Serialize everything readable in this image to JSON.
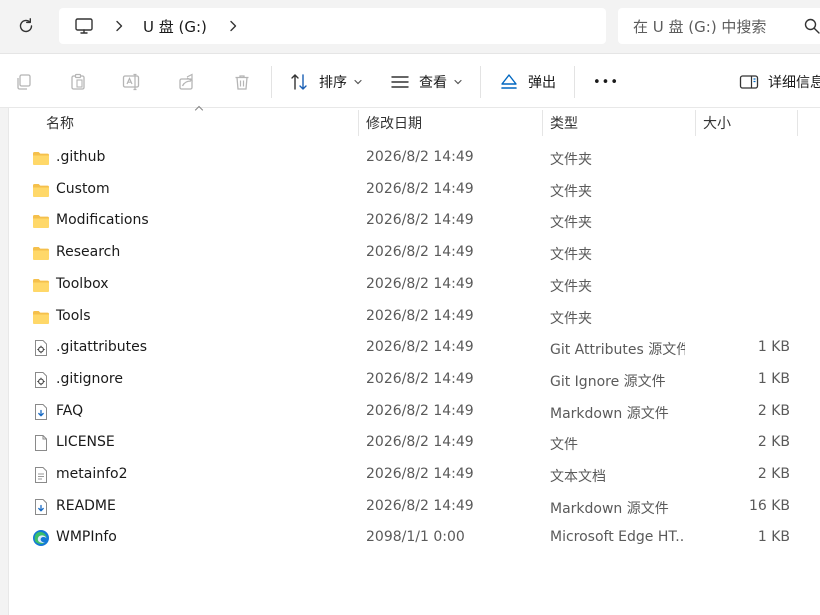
{
  "address": {
    "crumbs": [
      "U 盘 (G:)"
    ],
    "search_placeholder": "在 U 盘 (G:) 中搜索"
  },
  "icons": {
    "refresh": "refresh-icon",
    "pc": "computer-icon",
    "copy": "copy-icon",
    "paste": "paste-icon",
    "rename": "rename-icon",
    "share": "share-icon",
    "delete": "delete-icon",
    "sort": "sort-icon",
    "view": "view-icon",
    "eject": "eject-icon",
    "more": "more-icon",
    "details": "details-pane-icon"
  },
  "toolbar": {
    "sort_label": "排序",
    "view_label": "查看",
    "eject_label": "弹出",
    "more_label": "•••",
    "details_label": "详细信息"
  },
  "columns": {
    "name": "名称",
    "date": "修改日期",
    "type": "类型",
    "size": "大小"
  },
  "colors": {
    "folder": "#f5c04c",
    "accent": "#0067c0",
    "edge_blue": "#1479d6",
    "edge_green": "#3bbf6a"
  },
  "files": [
    {
      "name": ".github",
      "date": "2026/8/2 14:49",
      "type": "文件夹",
      "size": "",
      "icon": "folder"
    },
    {
      "name": "Custom",
      "date": "2026/8/2 14:49",
      "type": "文件夹",
      "size": "",
      "icon": "folder"
    },
    {
      "name": "Modifications",
      "date": "2026/8/2 14:49",
      "type": "文件夹",
      "size": "",
      "icon": "folder"
    },
    {
      "name": "Research",
      "date": "2026/8/2 14:49",
      "type": "文件夹",
      "size": "",
      "icon": "folder"
    },
    {
      "name": "Toolbox",
      "date": "2026/8/2 14:49",
      "type": "文件夹",
      "size": "",
      "icon": "folder"
    },
    {
      "name": "Tools",
      "date": "2026/8/2 14:49",
      "type": "文件夹",
      "size": "",
      "icon": "folder"
    },
    {
      "name": ".gitattributes",
      "date": "2026/8/2 14:49",
      "type": "Git Attributes 源文件",
      "size": "1 KB",
      "icon": "config"
    },
    {
      "name": ".gitignore",
      "date": "2026/8/2 14:49",
      "type": "Git Ignore 源文件",
      "size": "1 KB",
      "icon": "config"
    },
    {
      "name": "FAQ",
      "date": "2026/8/2 14:49",
      "type": "Markdown 源文件",
      "size": "2 KB",
      "icon": "markdown"
    },
    {
      "name": "LICENSE",
      "date": "2026/8/2 14:49",
      "type": "文件",
      "size": "2 KB",
      "icon": "file"
    },
    {
      "name": "metainfo2",
      "date": "2026/8/2 14:49",
      "type": "文本文档",
      "size": "2 KB",
      "icon": "text"
    },
    {
      "name": "README",
      "date": "2026/8/2 14:49",
      "type": "Markdown 源文件",
      "size": "16 KB",
      "icon": "markdown"
    },
    {
      "name": "WMPInfo",
      "date": "2098/1/1 0:00",
      "type": "Microsoft Edge HT...",
      "size": "1 KB",
      "icon": "edge"
    }
  ]
}
